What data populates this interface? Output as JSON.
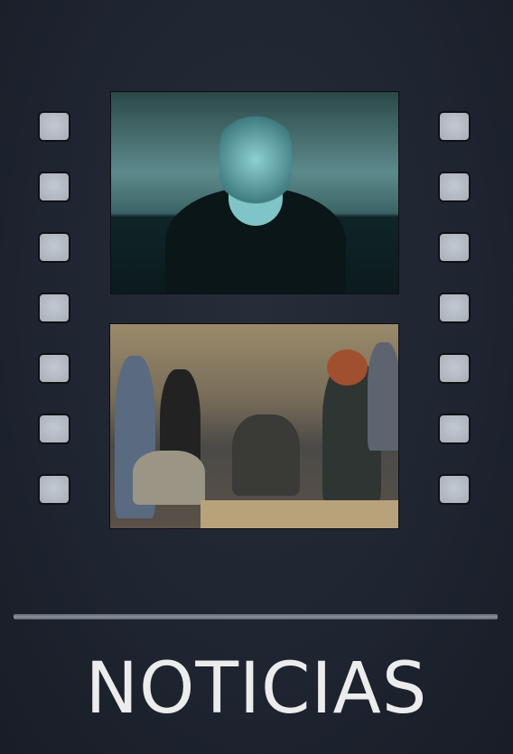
{
  "title": "NOTICIAS",
  "colors": {
    "background": "#1e2430",
    "sprocket": "#b5bbc4",
    "text": "#ececec"
  },
  "sprocket_holes_per_side": 7,
  "images": [
    "video-surveillance-face-photo",
    "newsroom-office-photo"
  ]
}
